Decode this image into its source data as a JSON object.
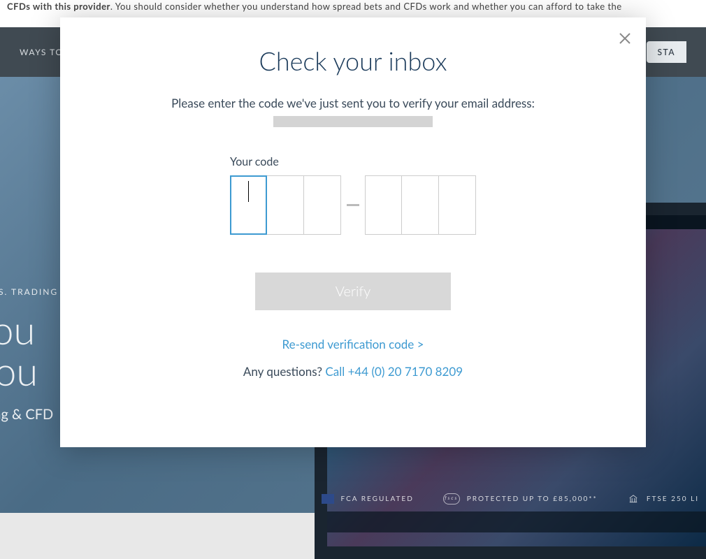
{
  "background": {
    "warning": {
      "bold_part": "CFDs with this provider",
      "rest": ". You should consider whether you understand how spread bets and CFDs work and whether you can afford to take the"
    },
    "nav": {
      "left_item": "WAYS TO T",
      "right_button": "STA"
    },
    "hero": {
      "tagline": "ETS. TRADING SIN",
      "title_line1": "ck ou",
      "title_line2": "d you",
      "subtitle": "betting & CFD"
    },
    "footer": {
      "items": [
        {
          "icon": "uk-flag-icon",
          "label": "FCA REGULATED"
        },
        {
          "icon": "fca-badge-icon",
          "label": "PROTECTED UP TO £85,000**"
        },
        {
          "icon": "bank-icon",
          "label": "FTSE 250 LI"
        }
      ]
    }
  },
  "modal": {
    "title": "Check your inbox",
    "subtitle": "Please enter the code we've just sent you to verify your email address:",
    "code_label": "Your code",
    "verify_button": "Verify",
    "resend_link": "Re-send verification code >",
    "questions_text": "Any questions?  ",
    "phone_link": "Call +44 (0) 20 7170 8209"
  }
}
